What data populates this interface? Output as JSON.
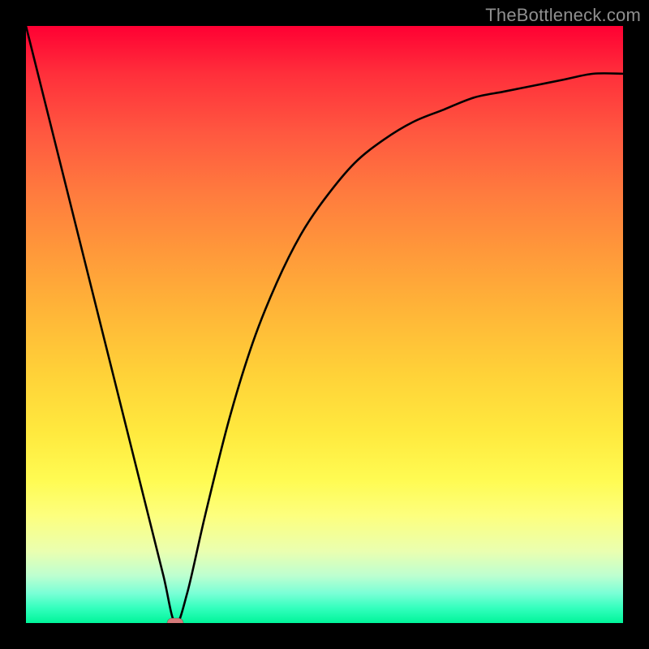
{
  "watermark": "TheBottleneck.com",
  "chart_data": {
    "type": "line",
    "title": "",
    "xlabel": "",
    "ylabel": "",
    "xlim": [
      0,
      1
    ],
    "ylim": [
      0,
      1
    ],
    "grid": false,
    "legend": false,
    "series": [
      {
        "name": "bottleneck-curve",
        "x": [
          0.0,
          0.05,
          0.1,
          0.15,
          0.2,
          0.23,
          0.25,
          0.27,
          0.3,
          0.34,
          0.38,
          0.42,
          0.46,
          0.5,
          0.55,
          0.6,
          0.65,
          0.7,
          0.75,
          0.8,
          0.85,
          0.9,
          0.95,
          1.0
        ],
        "y": [
          1.0,
          0.8,
          0.6,
          0.4,
          0.2,
          0.08,
          0.0,
          0.05,
          0.18,
          0.34,
          0.47,
          0.57,
          0.65,
          0.71,
          0.77,
          0.81,
          0.84,
          0.86,
          0.88,
          0.89,
          0.9,
          0.91,
          0.92,
          0.92
        ]
      }
    ],
    "marker": {
      "name": "min-point",
      "x": 0.25,
      "y": 0.0,
      "color": "#d47a7a",
      "shape": "pill"
    }
  },
  "layout": {
    "outer_size": 800,
    "border": 32,
    "plot_size": 736
  }
}
